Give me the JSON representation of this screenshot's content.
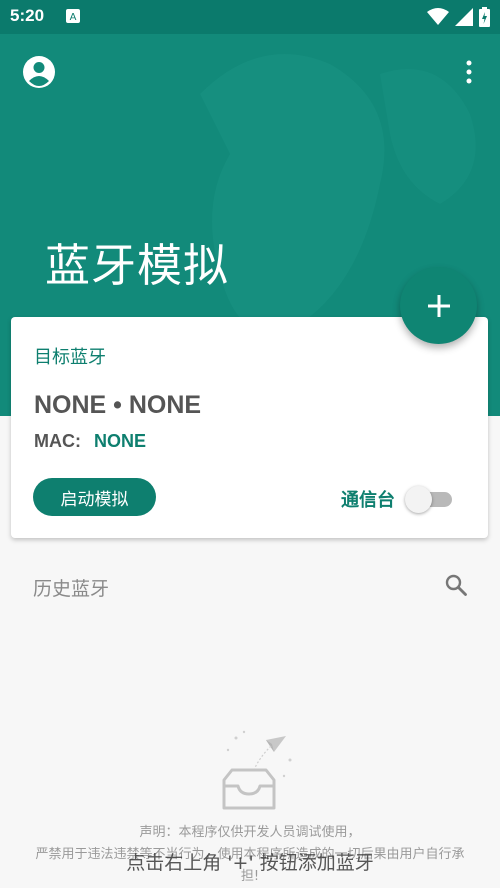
{
  "status_bar": {
    "time": "5:20",
    "icons": [
      "app-notification-icon",
      "wifi-icon",
      "signal-icon",
      "battery-icon"
    ]
  },
  "header": {
    "title": "蓝牙模拟",
    "account_icon": "account-circle-icon",
    "menu_icon": "more-vert-icon"
  },
  "fab": {
    "icon": "plus-icon"
  },
  "target_card": {
    "title": "目标蓝牙",
    "device_name": "NONE • NONE",
    "mac_label": "MAC:",
    "mac_value": "NONE",
    "start_button": "启动模拟",
    "console_label": "通信台",
    "console_enabled": false
  },
  "history": {
    "title": "历史蓝牙",
    "search_icon": "search-icon"
  },
  "empty_state": {
    "illustration": "empty-inbox-icon",
    "hint": "点击右上角 '+' 按钮添加蓝牙"
  },
  "disclaimer": {
    "line1": "声明：本程序仅供开发人员调试使用，",
    "line2": "严禁用于违法违禁等不当行为，使用本程序所造成的一切后果由用户自行承",
    "line3": "担!"
  },
  "colors": {
    "primary": "#128a7a",
    "primary_dark": "#0b7a6c",
    "accent": "#0e7f6f"
  }
}
